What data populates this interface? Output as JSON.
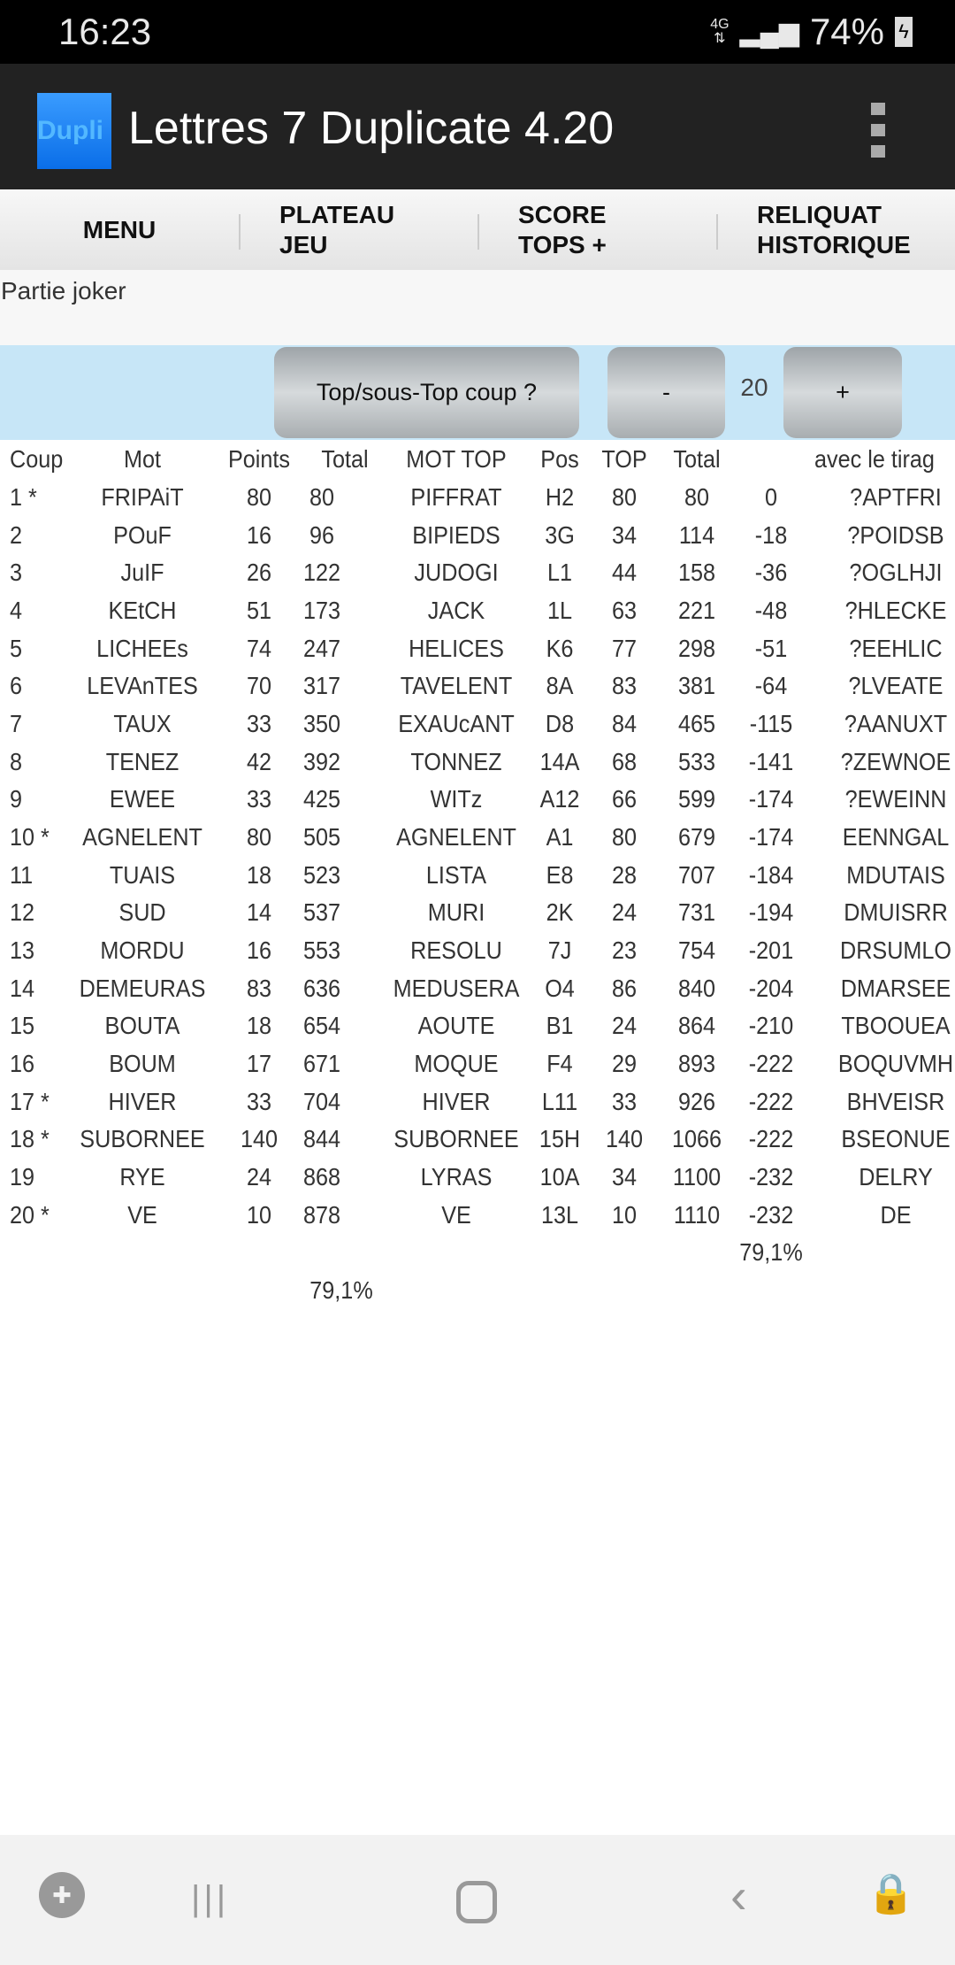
{
  "status_bar": {
    "time": "16:23",
    "network": "4G",
    "battery": "74%"
  },
  "app_bar": {
    "logo_text": "Dupli",
    "title": "Lettres 7 Duplicate 4.20"
  },
  "tabs": [
    {
      "line1": "MENU",
      "line2": ""
    },
    {
      "line1": "PLATEAU",
      "line2": "JEU"
    },
    {
      "line1": "SCORE",
      "line2": "TOPS +"
    },
    {
      "line1": "RELIQUAT",
      "line2": "HISTORIQUE"
    }
  ],
  "info_text": "Partie joker",
  "controls": {
    "top_button": "Top/sous-Top coup ?",
    "minus": "-",
    "count": "20",
    "plus": "+"
  },
  "table": {
    "headers": [
      "Coup",
      "Mot",
      "Points",
      "Total",
      "MOT TOP",
      "Pos",
      "TOP",
      "Total",
      "",
      "avec le tirag"
    ],
    "rows": [
      [
        "1 *",
        "FRIPAiT",
        "80",
        "80",
        "PIFFRAT",
        "H2",
        "80",
        "80",
        "0",
        "?APTFRI"
      ],
      [
        "2",
        "POuF",
        "16",
        "96",
        "BIPIEDS",
        "3G",
        "34",
        "114",
        "-18",
        "?POIDSB"
      ],
      [
        "3",
        "JuIF",
        "26",
        "122",
        "JUDOGI",
        "L1",
        "44",
        "158",
        "-36",
        "?OGLHJI"
      ],
      [
        "4",
        "KEtCH",
        "51",
        "173",
        "JACK",
        "1L",
        "63",
        "221",
        "-48",
        "?HLECKE"
      ],
      [
        "5",
        "LICHEEs",
        "74",
        "247",
        "HELICES",
        "K6",
        "77",
        "298",
        "-51",
        "?EEHLIC"
      ],
      [
        "6",
        "LEVAnTES",
        "70",
        "317",
        "TAVELENT",
        "8A",
        "83",
        "381",
        "-64",
        "?LVEATE"
      ],
      [
        "7",
        "TAUX",
        "33",
        "350",
        "EXAUcANT",
        "D8",
        "84",
        "465",
        "-115",
        "?AANUXT"
      ],
      [
        "8",
        "TENEZ",
        "42",
        "392",
        "TONNEZ",
        "14A",
        "68",
        "533",
        "-141",
        "?ZEWNOE"
      ],
      [
        "9",
        "EWEE",
        "33",
        "425",
        "WITz",
        "A12",
        "66",
        "599",
        "-174",
        "?EWEINN"
      ],
      [
        "10 *",
        "AGNELENT",
        "80",
        "505",
        "AGNELENT",
        "A1",
        "80",
        "679",
        "-174",
        "EENNGAL"
      ],
      [
        "11",
        "TUAIS",
        "18",
        "523",
        "LISTA",
        "E8",
        "28",
        "707",
        "-184",
        "MDUTAIS"
      ],
      [
        "12",
        "SUD",
        "14",
        "537",
        "MURI",
        "2K",
        "24",
        "731",
        "-194",
        "DMUISRR"
      ],
      [
        "13",
        "MORDU",
        "16",
        "553",
        "RESOLU",
        "7J",
        "23",
        "754",
        "-201",
        "DRSUMLO"
      ],
      [
        "14",
        "DEMEURAS",
        "83",
        "636",
        "MEDUSERA",
        "O4",
        "86",
        "840",
        "-204",
        "DMARSEE"
      ],
      [
        "15",
        "BOUTA",
        "18",
        "654",
        "AOUTE",
        "B1",
        "24",
        "864",
        "-210",
        "TBOOUEA"
      ],
      [
        "16",
        "BOUM",
        "17",
        "671",
        "MOQUE",
        "F4",
        "29",
        "893",
        "-222",
        "BOQUVMH"
      ],
      [
        "17 *",
        "HIVER",
        "33",
        "704",
        "HIVER",
        "L11",
        "33",
        "926",
        "-222",
        "BHVEISR"
      ],
      [
        "18 *",
        "SUBORNEE",
        "140",
        "844",
        "SUBORNEE",
        "15H",
        "140",
        "1066",
        "-222",
        "BSEONUE"
      ],
      [
        "19",
        "RYE",
        "24",
        "868",
        "LYRAS",
        "10A",
        "34",
        "1100",
        "-232",
        "DELRY"
      ],
      [
        "20 *",
        "VE",
        "10",
        "878",
        "VE",
        "13L",
        "10",
        "1110",
        "-232",
        "DE"
      ]
    ],
    "summary_diff_pct": "79,1%",
    "summary_total_pct": "79,1%"
  },
  "nav_bar": {
    "icons": [
      "game-launcher-icon",
      "recent-apps-icon",
      "home-icon",
      "back-icon",
      "touch-lock-icon"
    ]
  }
}
